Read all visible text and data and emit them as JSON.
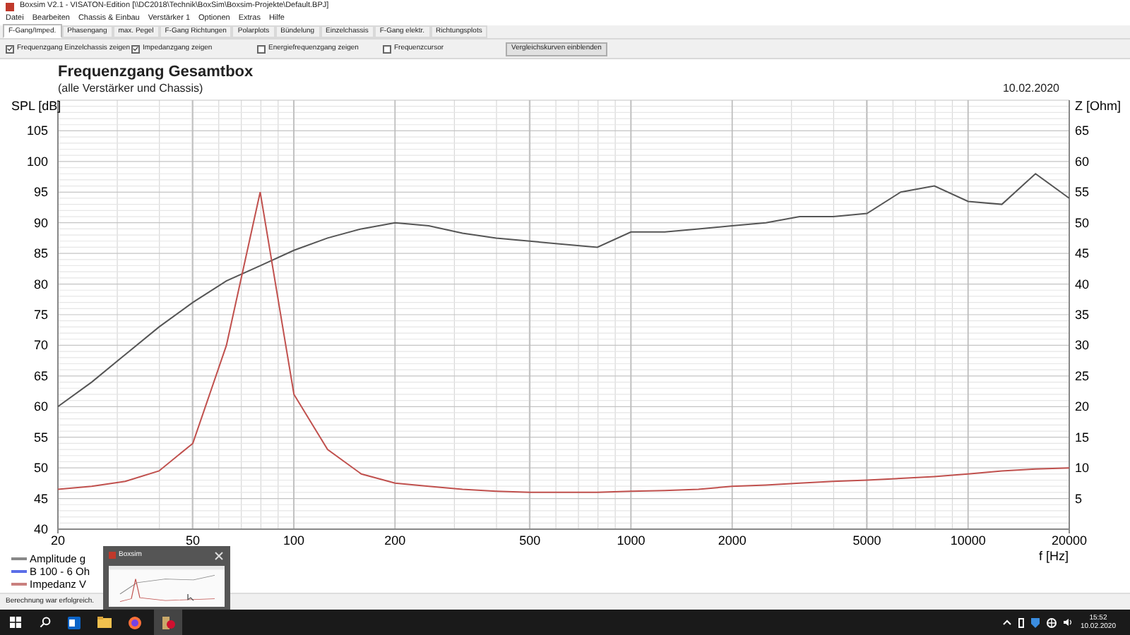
{
  "window": {
    "title": "Boxsim V2.1 - VISATON-Edition [\\\\DC2018\\Technik\\BoxSim\\Boxsim-Projekte\\Default.BPJ]"
  },
  "menu": [
    "Datei",
    "Bearbeiten",
    "Chassis & Einbau",
    "Verstärker 1",
    "Optionen",
    "Extras",
    "Hilfe"
  ],
  "tabs": [
    {
      "label": "F-Gang/Imped.",
      "selected": true
    },
    {
      "label": "Phasengang",
      "selected": false
    },
    {
      "label": "max. Pegel",
      "selected": false
    },
    {
      "label": "F-Gang Richtungen",
      "selected": false
    },
    {
      "label": "Polarplots",
      "selected": false
    },
    {
      "label": "Bündelung",
      "selected": false
    },
    {
      "label": "Einzelchassis",
      "selected": false
    },
    {
      "label": "F-Gang elektr.",
      "selected": false
    },
    {
      "label": "Richtungsplots",
      "selected": false
    }
  ],
  "options": [
    {
      "label": "Frequenzgang Einzelchassis zeigen",
      "checked": true
    },
    {
      "label": "Impedanzgang zeigen",
      "checked": true
    },
    {
      "label": "Energiefrequenzgang zeigen",
      "checked": false
    },
    {
      "label": "Frequenzcursor",
      "checked": false
    }
  ],
  "compare_button": "Vergleichskurven einblenden",
  "plot": {
    "title": "Frequenzgang Gesamtbox",
    "subtitle": "(alle Verstärker und Chassis)",
    "date": "10.02.2020",
    "chart_data": {
      "type": "line",
      "xlabel": "f [Hz]",
      "ylabel": "SPL [dB]",
      "y2label": "Z [Ohm]",
      "grid": true,
      "ylim": [
        40,
        110
      ],
      "y2lim": [
        0,
        70
      ],
      "yticks": [
        40,
        45,
        50,
        55,
        60,
        65,
        70,
        75,
        80,
        85,
        90,
        95,
        100,
        105
      ],
      "y2ticks": [
        5,
        10,
        15,
        20,
        25,
        30,
        35,
        40,
        45,
        50,
        55,
        60,
        65
      ],
      "categories": [
        "20",
        null,
        null,
        null,
        "50",
        null,
        null,
        "100",
        null,
        null,
        "200",
        null,
        null,
        null,
        "500",
        null,
        null,
        "1000",
        null,
        null,
        "2000",
        null,
        null,
        null,
        "5000",
        null,
        null,
        "10000",
        null,
        null,
        "20000"
      ],
      "series": [
        {
          "color": "#555555",
          "values": [
            60,
            64,
            68.5,
            73,
            77,
            80.5,
            83,
            85.5,
            87.5,
            89,
            90,
            89.5,
            88.3,
            87.5,
            87,
            86.5,
            86,
            88.5,
            88.5,
            89,
            89.5,
            90,
            91,
            91,
            91.5,
            95,
            96,
            93.5,
            93,
            98,
            94
          ]
        },
        {
          "color": "#c0504d",
          "axis": "y2",
          "values": [
            6.5,
            7,
            7.8,
            9.5,
            14,
            30,
            55,
            22,
            13,
            9,
            7.5,
            7,
            6.5,
            6.2,
            6,
            6,
            6,
            6.2,
            6.3,
            6.5,
            7,
            7.2,
            7.5,
            7.8,
            8,
            8.3,
            8.6,
            9,
            9.5,
            9.8,
            10
          ]
        }
      ]
    },
    "legend": [
      {
        "label": "Amplitude g",
        "color": "#888888"
      },
      {
        "label": "B 100 - 6 Oh",
        "color": "#5b6ee8"
      },
      {
        "label": "Impedanz V",
        "color": "#c9807e"
      }
    ]
  },
  "thumbnail_popup": {
    "title": "Boxsim"
  },
  "status_bar": "Berechnung war erfolgreich.",
  "taskbar": {
    "time": "15:52",
    "date": "10.02.2020"
  }
}
